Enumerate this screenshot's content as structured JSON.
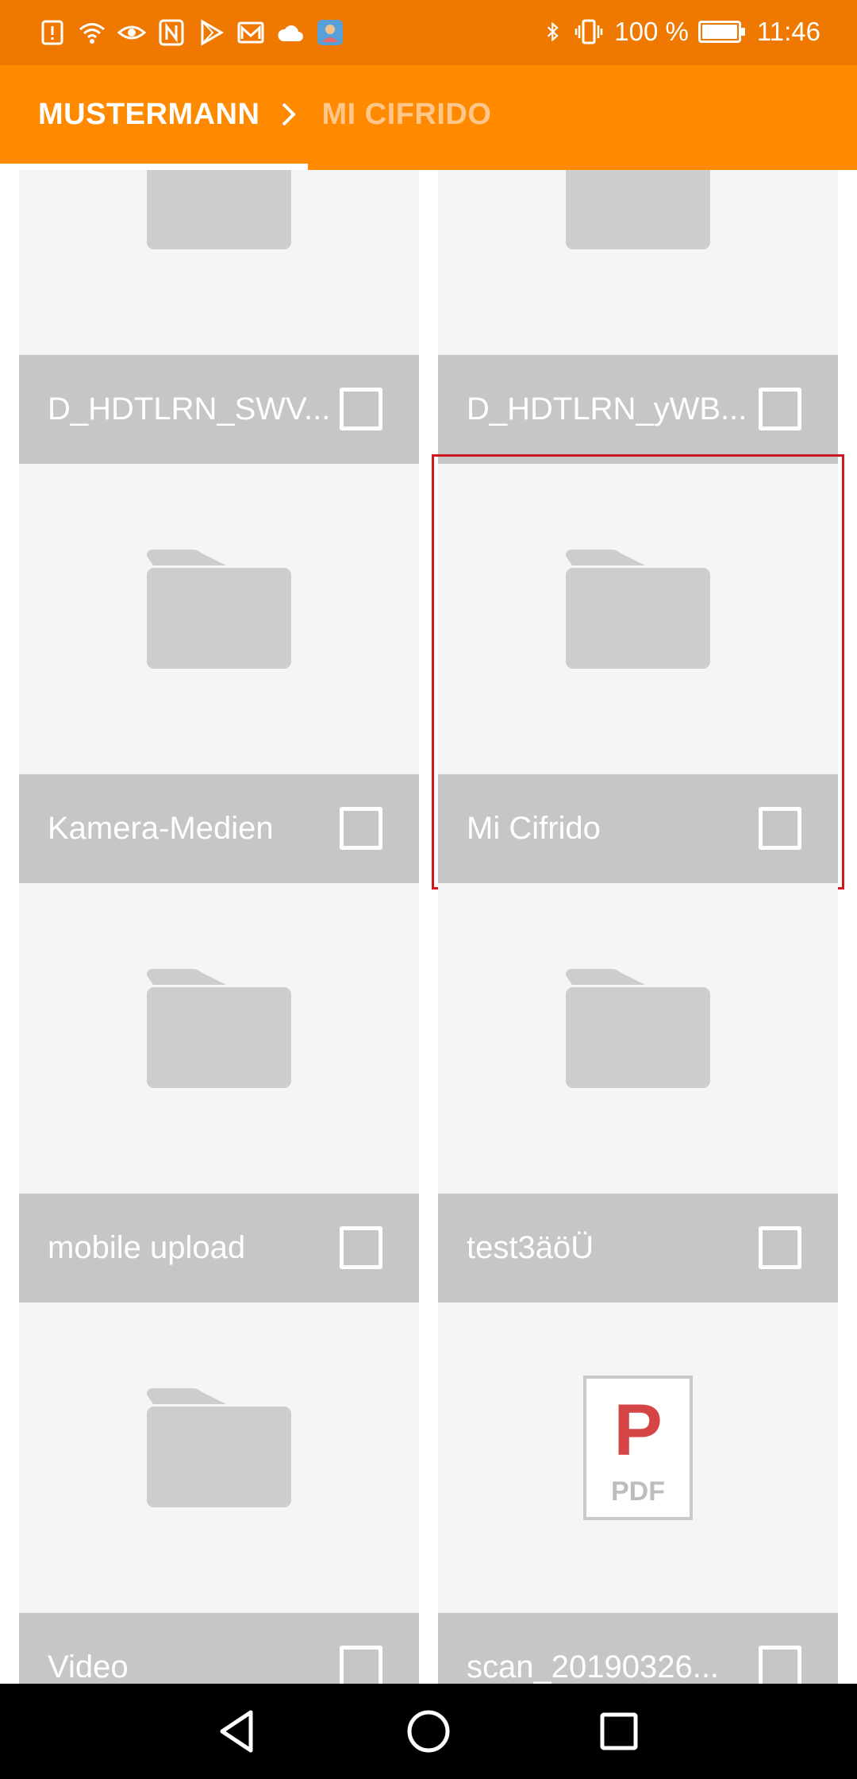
{
  "status_bar": {
    "left_icons": [
      "alert-icon",
      "wifi-icon",
      "eye-icon",
      "nfc-icon",
      "play-store-icon",
      "mail-icon",
      "cloud-icon",
      "app-icon"
    ],
    "battery_percent_label": "100 %",
    "battery_level": 1.0,
    "time": "11:46"
  },
  "breadcrumb": {
    "root": "MUSTERMANN",
    "current": "MI CIFRIDO"
  },
  "files": [
    {
      "name": "D_HDTLRN_SWV...",
      "type": "folder"
    },
    {
      "name": "D_HDTLRN_yWB...",
      "type": "folder"
    },
    {
      "name": "Kamera-Medien",
      "type": "folder"
    },
    {
      "name": "Mi Cifrido",
      "type": "folder",
      "highlighted": true
    },
    {
      "name": "mobile upload",
      "type": "folder"
    },
    {
      "name": "test3äöÜ",
      "type": "folder"
    },
    {
      "name": "Video",
      "type": "folder"
    },
    {
      "name": "scan_20190326...",
      "type": "pdf",
      "icon_letter": "P",
      "icon_label": "PDF"
    }
  ],
  "colors": {
    "status_bar": "#ef7800",
    "app_bar": "#ff8a00",
    "tile_bg": "#f5f5f5",
    "tile_footer": "#c6c6c6",
    "folder": "#cdcdcd",
    "pdf_red": "#d64545",
    "highlight": "#d0191f"
  },
  "nav_bar": {
    "buttons": [
      "back-icon",
      "home-icon",
      "recents-icon"
    ]
  }
}
